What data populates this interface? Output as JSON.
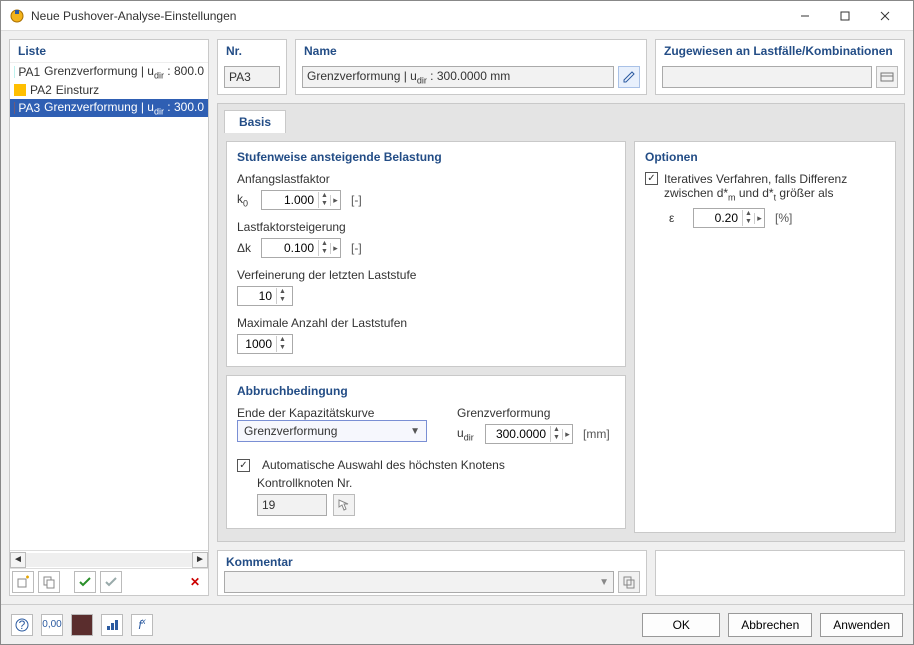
{
  "title": "Neue Pushover-Analyse-Einstellungen",
  "liste": {
    "header": "Liste",
    "items": [
      {
        "pa": "PA1",
        "text": "Grenzverformung | u",
        "sub": "dir",
        "suffix": " : 800.0",
        "color": "#bff2ee"
      },
      {
        "pa": "PA2",
        "text": "Einsturz",
        "color": "#ffbf00"
      },
      {
        "pa": "PA3",
        "text": "Grenzverformung | u",
        "sub": "dir",
        "suffix": " : 300.0",
        "color": "#6f5a7a",
        "selected": true
      }
    ]
  },
  "nr": {
    "header": "Nr.",
    "value": "PA3"
  },
  "name": {
    "header": "Name",
    "value_prefix": "Grenzverformung | u",
    "value_sub": "dir",
    "value_suffix": " : 300.0000 mm"
  },
  "assigned": {
    "header": "Zugewiesen an Lastfälle/Kombinationen",
    "value": ""
  },
  "tabs": {
    "basis": "Basis"
  },
  "loading": {
    "header": "Stufenweise ansteigende Belastung",
    "k0_label": "Anfangslastfaktor",
    "k0_sym": "k",
    "k0_sub": "0",
    "k0_val": "1.000",
    "k0_unit": "[-]",
    "dk_label": "Lastfaktorsteigerung",
    "dk_sym": "Δk",
    "dk_val": "0.100",
    "dk_unit": "[-]",
    "refine_label": "Verfeinerung der letzten Laststufe",
    "refine_val": "10",
    "max_label": "Maximale Anzahl der Laststufen",
    "max_val": "1000"
  },
  "stop": {
    "header": "Abbruchbedingung",
    "end_label": "Ende der Kapazitätskurve",
    "end_value": "Grenzverformung",
    "gv_label": "Grenzverformung",
    "udir_sym": "u",
    "udir_sub": "dir",
    "udir_val": "300.0000",
    "udir_unit": "[mm]",
    "auto_label": "Automatische Auswahl des höchsten Knotens",
    "ctrl_label": "Kontrollknoten Nr.",
    "ctrl_val": "19"
  },
  "options": {
    "header": "Optionen",
    "iter_l1": "Iteratives Verfahren, falls Differenz",
    "iter_l2_a": "zwischen d*",
    "iter_l2_sub1": "m",
    "iter_l2_b": " und d*",
    "iter_l2_sub2": "t",
    "iter_l2_c": " größer als",
    "eps_sym": "ε",
    "eps_val": "0.20",
    "eps_unit": "[%]"
  },
  "comment": {
    "header": "Kommentar",
    "value": ""
  },
  "footer": {
    "ok": "OK",
    "cancel": "Abbrechen",
    "apply": "Anwenden"
  }
}
